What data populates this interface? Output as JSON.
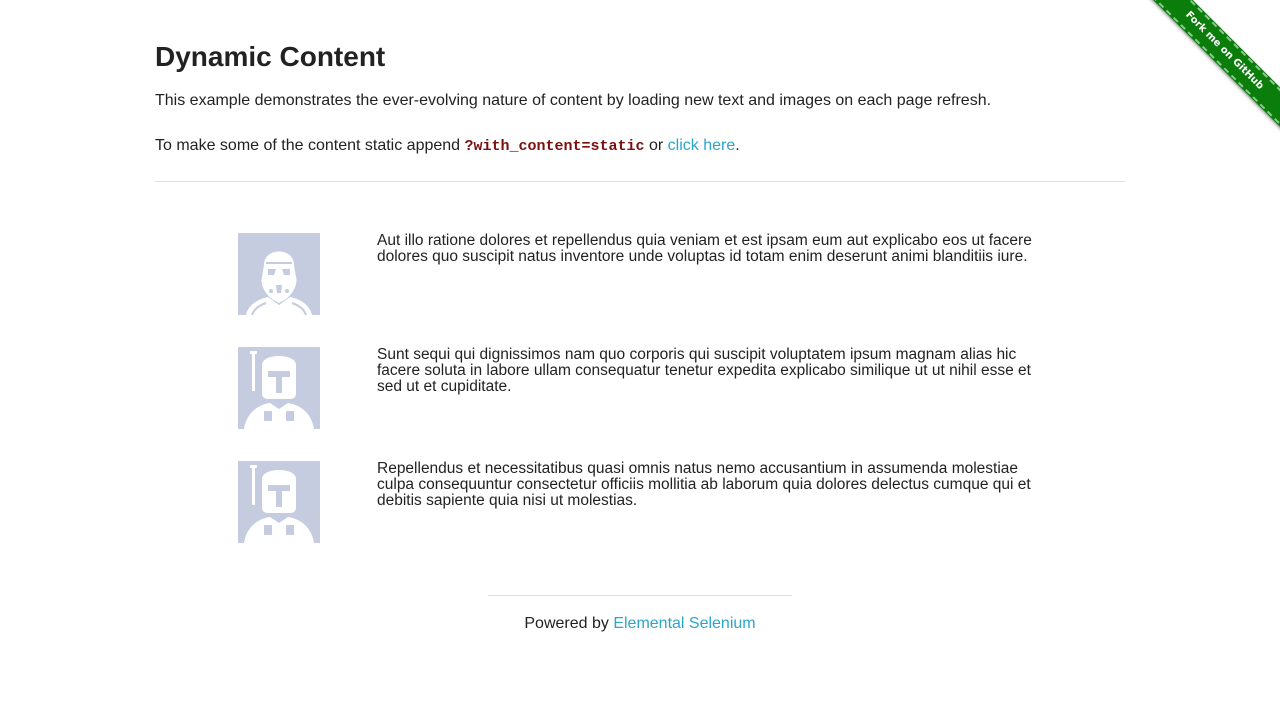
{
  "ribbon": {
    "label": "Fork me on GitHub"
  },
  "header": {
    "title": "Dynamic Content",
    "intro": "This example demonstrates the ever-evolving nature of content by loading new text and images on each page refresh.",
    "static_prefix": "To make some of the content static append ",
    "static_code": "?with_content=static",
    "static_or": " or ",
    "static_link": "click here",
    "static_suffix": "."
  },
  "rows": [
    {
      "avatar": "stormtrooper-avatar",
      "text": "Aut illo ratione dolores et repellendus quia veniam et est ipsam eum aut explicabo eos ut facere dolores quo suscipit natus inventore unde voluptas id totam enim deserunt animi blanditiis iure."
    },
    {
      "avatar": "boba-fett-avatar",
      "text": "Sunt sequi qui dignissimos nam quo corporis qui suscipit voluptatem ipsum magnam alias hic facere soluta in labore ullam consequatur tenetur expedita explicabo similique ut ut nihil esse et sed ut et cupiditate."
    },
    {
      "avatar": "boba-fett-avatar",
      "text": "Repellendus et necessitatibus quasi omnis natus nemo accusantium in assumenda molestiae culpa consequuntur consectetur officiis mollitia ab laborum quia dolores delectus cumque qui et debitis sapiente quia nisi ut molestias."
    }
  ],
  "footer": {
    "prefix": "Powered by ",
    "link": "Elemental Selenium"
  },
  "colors": {
    "link": "#2ba6cb",
    "ribbon": "#0a7d0a",
    "avatar_bg": "#c5cce0",
    "code": "#7a0f0f"
  }
}
